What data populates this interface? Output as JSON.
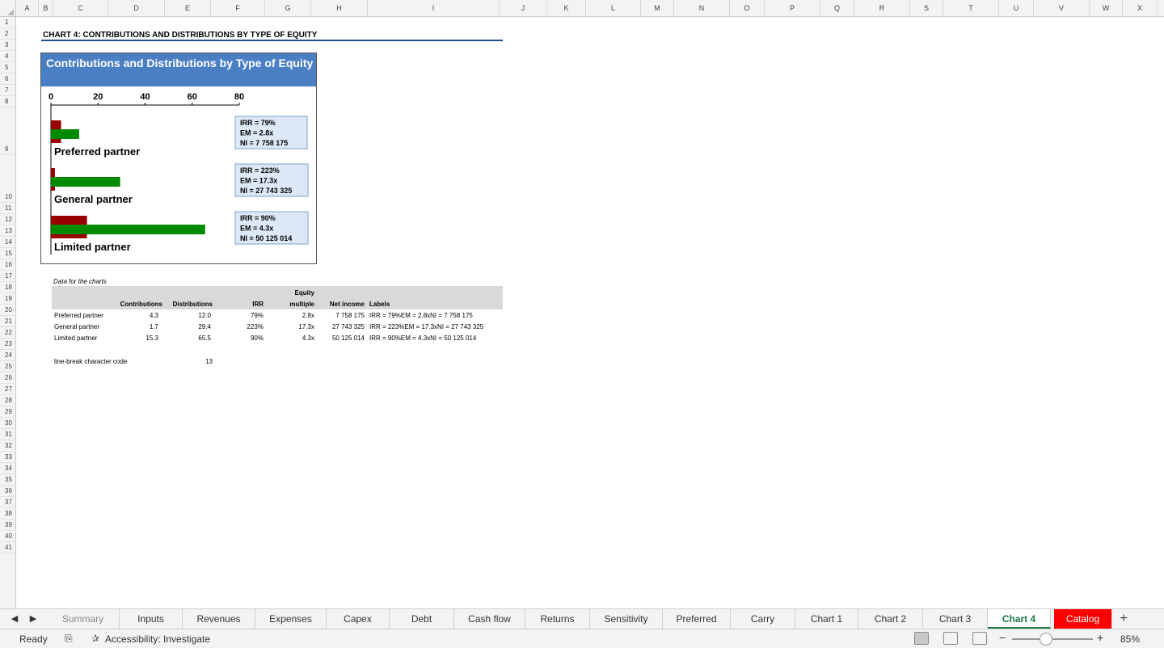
{
  "columns": [
    "A",
    "B",
    "C",
    "D",
    "E",
    "F",
    "G",
    "H",
    "I",
    "J",
    "K",
    "L",
    "M",
    "N",
    "O",
    "P",
    "Q",
    "R",
    "S",
    "T",
    "U",
    "V",
    "W",
    "X"
  ],
  "rows": [
    "1",
    "2",
    "3",
    "4",
    "5",
    "6",
    "7",
    "8",
    "9",
    "10",
    "11",
    "12",
    "13",
    "14",
    "15",
    "16",
    "17",
    "18",
    "19",
    "20",
    "21",
    "22",
    "23",
    "24",
    "25",
    "26",
    "27",
    "28",
    "29",
    "30",
    "31",
    "32",
    "33",
    "34",
    "35",
    "36",
    "37",
    "38",
    "39",
    "40",
    "41"
  ],
  "sheet_title": "CHART 4: CONTRIBUTIONS AND DISTRIBUTIONS BY TYPE OF EQUITY",
  "chart_data": {
    "type": "bar",
    "orientation": "horizontal",
    "title": "Contributions and Distributions by Type of Equity",
    "categories": [
      "Preferred partner",
      "General partner",
      "Limited partner"
    ],
    "series": [
      {
        "name": "Contributions",
        "values": [
          4.3,
          1.7,
          15.3
        ],
        "color": "#990000"
      },
      {
        "name": "Distributions",
        "values": [
          12.0,
          29.4,
          65.5
        ],
        "color": "#008a00"
      }
    ],
    "xlim": [
      0,
      80
    ],
    "xticks": [
      "0",
      "20",
      "40",
      "60",
      "80"
    ],
    "axis_position": "top",
    "grid": false,
    "legend": "none",
    "annotations": [
      [
        "IRR = 79%",
        "EM = 2.8x",
        "NI = 7 758 175"
      ],
      [
        "IRR = 223%",
        "EM = 17.3x",
        "NI = 27 743 325"
      ],
      [
        "IRR = 90%",
        "EM = 4.3x",
        "NI = 50 125 014"
      ]
    ],
    "annotation_bg": "#dce8f5",
    "header_color": "#4a7fc4"
  },
  "data_table": {
    "caption": "Data for the charts",
    "headers": {
      "contributions": "Contributions",
      "distributions": "Distributions",
      "irr": "IRR",
      "em_1": "Equity",
      "em_2": "multiple",
      "net_income": "Net income",
      "labels": "Labels"
    },
    "rows": [
      {
        "name": "Preferred partner",
        "contributions": "4.3",
        "distributions": "12.0",
        "irr": "79%",
        "em": "2.8x",
        "net_income": "7 758 175",
        "label": "IRR = 79%EM = 2.8xNI = 7 758 175"
      },
      {
        "name": "General partner",
        "contributions": "1.7",
        "distributions": "29.4",
        "irr": "223%",
        "em": "17.3x",
        "net_income": "27 743 325",
        "label": "IRR = 223%EM = 17.3xNI = 27 743 325"
      },
      {
        "name": "Limited partner",
        "contributions": "15.3",
        "distributions": "65.5",
        "irr": "90%",
        "em": "4.3x",
        "net_income": "50 125 014",
        "label": "IRR = 90%EM = 4.3xNI = 50 125 014"
      }
    ],
    "linebreak_label": "line-break character code",
    "linebreak_value": "13"
  },
  "tabs": [
    "Summary",
    "Inputs",
    "Revenues",
    "Expenses",
    "Capex",
    "Debt",
    "Cash flow",
    "Returns",
    "Sensitivity",
    "Preferred",
    "Carry",
    "Chart 1",
    "Chart 2",
    "Chart 3",
    "Chart 4",
    "Catalog"
  ],
  "active_tab": "Chart 4",
  "status": {
    "ready": "Ready",
    "accessibility": "Accessibility: Investigate",
    "zoom": "85%",
    "zoom_fraction": 0.34
  },
  "icons": {
    "prev_sheet": "chevron-left-icon",
    "next_sheet": "chevron-right-icon",
    "add_sheet": "plus-icon",
    "macro": "macro-recording-icon",
    "accessibility": "accessibility-icon"
  },
  "colors": {
    "active_tab": "#1d7a45",
    "catalog_tab": "#ff0000",
    "title_underline": "#1f4e8c"
  }
}
